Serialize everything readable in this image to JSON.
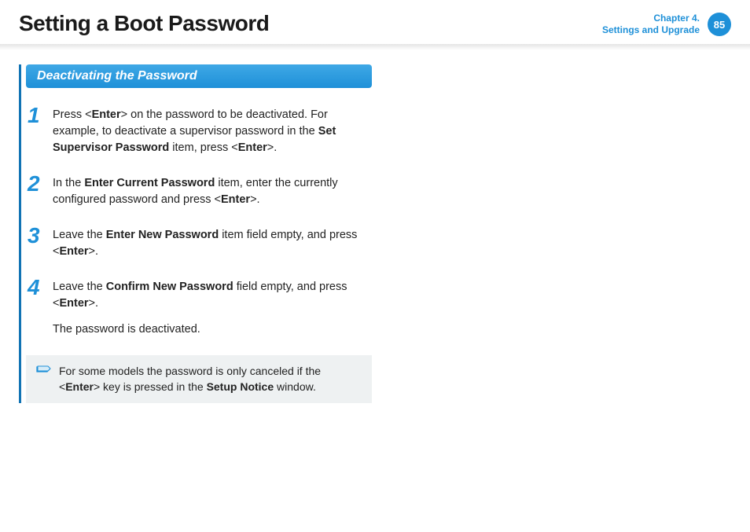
{
  "header": {
    "title": "Setting a Boot Password",
    "chapter_line1": "Chapter 4.",
    "chapter_line2": "Settings and Upgrade",
    "page_number": "85"
  },
  "section": {
    "heading": "Deactivating the Password"
  },
  "steps": [
    {
      "num": "1",
      "parts": [
        {
          "t": "Press <",
          "b": false
        },
        {
          "t": "Enter",
          "b": true
        },
        {
          "t": "> on the password to be deactivated. For example, to deactivate a supervisor password in the ",
          "b": false
        },
        {
          "t": "Set Supervisor Password",
          "b": true
        },
        {
          "t": " item, press <",
          "b": false
        },
        {
          "t": "Enter",
          "b": true
        },
        {
          "t": ">.",
          "b": false
        }
      ],
      "followup": null
    },
    {
      "num": "2",
      "parts": [
        {
          "t": "In the ",
          "b": false
        },
        {
          "t": "Enter Current Password",
          "b": true
        },
        {
          "t": " item, enter the currently configured password and press <",
          "b": false
        },
        {
          "t": "Enter",
          "b": true
        },
        {
          "t": ">.",
          "b": false
        }
      ],
      "followup": null
    },
    {
      "num": "3",
      "parts": [
        {
          "t": "Leave the ",
          "b": false
        },
        {
          "t": "Enter New Password",
          "b": true
        },
        {
          "t": " item field empty, and press <",
          "b": false
        },
        {
          "t": "Enter",
          "b": true
        },
        {
          "t": ">.",
          "b": false
        }
      ],
      "followup": null
    },
    {
      "num": "4",
      "parts": [
        {
          "t": "Leave the ",
          "b": false
        },
        {
          "t": "Confirm New Password",
          "b": true
        },
        {
          "t": " field empty, and press <",
          "b": false
        },
        {
          "t": "Enter",
          "b": true
        },
        {
          "t": ">.",
          "b": false
        }
      ],
      "followup": "The password is deactivated."
    }
  ],
  "note": {
    "parts": [
      {
        "t": "For some models the password is only canceled if the <",
        "b": false
      },
      {
        "t": "Enter",
        "b": true
      },
      {
        "t": "> key is pressed in the ",
        "b": false
      },
      {
        "t": "Setup Notice",
        "b": true
      },
      {
        "t": " window.",
        "b": false
      }
    ]
  }
}
